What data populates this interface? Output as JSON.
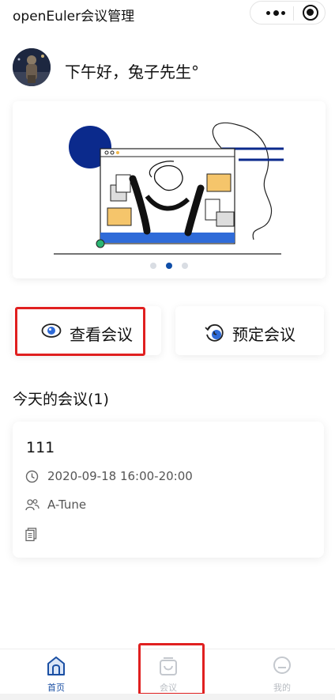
{
  "header": {
    "title": "openEuler会议管理"
  },
  "greeting": {
    "text": "下午好，兔子先生°"
  },
  "banner": {
    "slides": 3,
    "active_slide": 2
  },
  "actions": {
    "view_label": "查看会议",
    "book_label": "预定会议"
  },
  "today": {
    "title": "今天的会议(1)",
    "meetings": [
      {
        "name": "111",
        "time": "2020-09-18 16:00-20:00",
        "group": "A-Tune"
      }
    ]
  },
  "tabs": [
    {
      "label": "首页",
      "icon": "home-icon",
      "active": true
    },
    {
      "label": "会议",
      "icon": "meeting-icon",
      "active": false
    },
    {
      "label": "我的",
      "icon": "profile-icon",
      "active": false
    }
  ],
  "colors": {
    "accent": "#1a4fa3",
    "highlight": "#e02020",
    "banner_navy": "#0b2a8c"
  }
}
